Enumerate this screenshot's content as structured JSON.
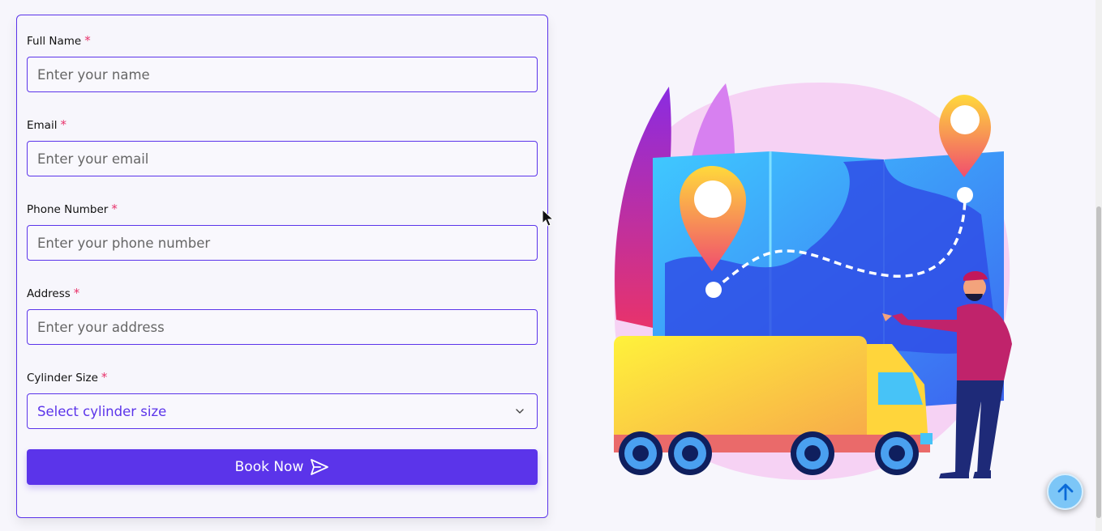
{
  "form": {
    "full_name": {
      "label": "Full Name",
      "required_mark": "*",
      "placeholder": "Enter your name",
      "value": ""
    },
    "email": {
      "label": "Email",
      "required_mark": "*",
      "placeholder": "Enter your email",
      "value": ""
    },
    "phone": {
      "label": "Phone Number",
      "required_mark": "*",
      "placeholder": "Enter your phone number",
      "value": ""
    },
    "address": {
      "label": "Address",
      "required_mark": "*",
      "placeholder": "Enter your address",
      "value": ""
    },
    "cylinder": {
      "label": "Cylinder Size",
      "required_mark": "*",
      "selected": "Select cylinder size"
    },
    "submit_label": "Book Now"
  },
  "colors": {
    "accent": "#5b34ea",
    "required": "#e8336b",
    "background": "#f7f6fc",
    "scroll_button": "#7cc6f7"
  },
  "icons": {
    "submit": "send-icon",
    "select": "chevron-down-icon",
    "scroll_top": "arrow-up-icon",
    "illustration": "delivery-truck-map-illustration"
  }
}
